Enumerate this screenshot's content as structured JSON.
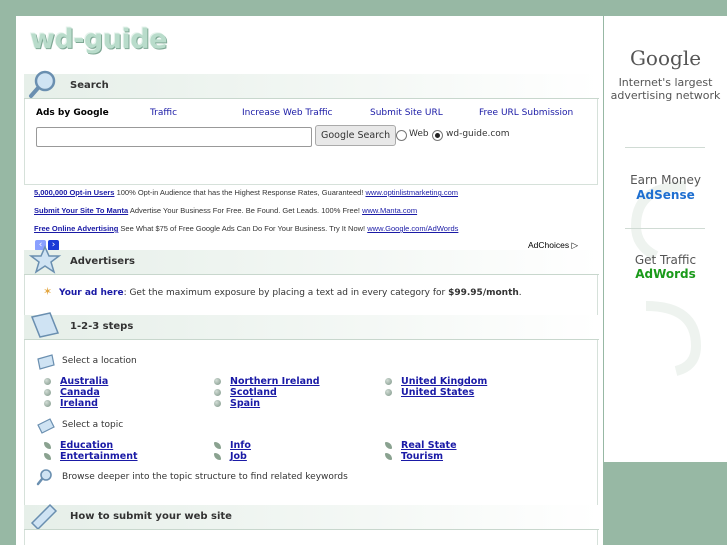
{
  "logo": "wd-guide",
  "search": {
    "title": "Search",
    "links": [
      "Ads by Google",
      "Traffic",
      "Increase Web Traffic",
      "Submit Site URL",
      "Free URL Submission"
    ],
    "input_value": "",
    "button": "Google Search",
    "radio_web": "Web",
    "radio_site": "wd-guide.com",
    "selected": "wd-guide.com"
  },
  "ads": [
    {
      "title": "5,000,000 Opt-in Users",
      "text": "100% Opt-in Audience that has the Highest Response Rates, Guaranteed!",
      "url": "www.optinlistmarketing.com"
    },
    {
      "title": "Submit Your Site To Manta",
      "text": "Advertise Your Business For Free. Be Found. Get Leads. 100% Free!",
      "url": "www.Manta.com"
    },
    {
      "title": "Free Online Advertising",
      "text": "See What $75 of Free Google Ads Can Do For Your Business. Try It Now!",
      "url": "www.Google.com/AdWords"
    }
  ],
  "ad_choices": "AdChoices",
  "advertisers": {
    "title": "Advertisers",
    "link": "Your ad here",
    "text": ": Get the maximum exposure by placing a text ad in every category for ",
    "price": "$99.95/month",
    "end": "."
  },
  "steps": {
    "title": "1-2-3 steps",
    "location_label": "Select a location",
    "locations": [
      [
        "Australia",
        "Canada",
        "Ireland"
      ],
      [
        "Northern Ireland",
        "Scotland",
        "Spain"
      ],
      [
        "United Kingdom",
        "United States"
      ]
    ],
    "topic_label": "Select a topic",
    "topics": [
      [
        "Education",
        "Entertainment"
      ],
      [
        "Info",
        "Job"
      ],
      [
        "Real State",
        "Tourism"
      ]
    ],
    "browse_text": "Browse deeper into the topic structure to find related keywords"
  },
  "howto": {
    "title": "How to submit your web site"
  },
  "sidebar": {
    "brand": "Google",
    "tagline": "Internet's largest advertising network",
    "earn": "Earn Money",
    "adsense": "AdSense",
    "traffic": "Get Traffic",
    "adwords": "AdWords"
  },
  "colors": {
    "background": "#97b8a4",
    "link": "#1a1aa6",
    "adsense": "#1e6fd0",
    "adwords": "#1a9a1a"
  }
}
